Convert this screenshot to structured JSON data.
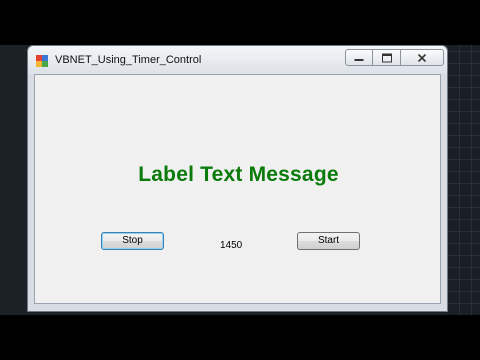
{
  "window": {
    "title": "VBNET_Using_Timer_Control",
    "icon": "winforms-app-icon",
    "caption_buttons": [
      "minimize-icon",
      "maximize-icon",
      "close-icon"
    ]
  },
  "form": {
    "label_text": "Label Text Message",
    "label_color": "#0a7a0a",
    "stop_button": "Stop",
    "start_button": "Start",
    "counter_value": "1450"
  }
}
